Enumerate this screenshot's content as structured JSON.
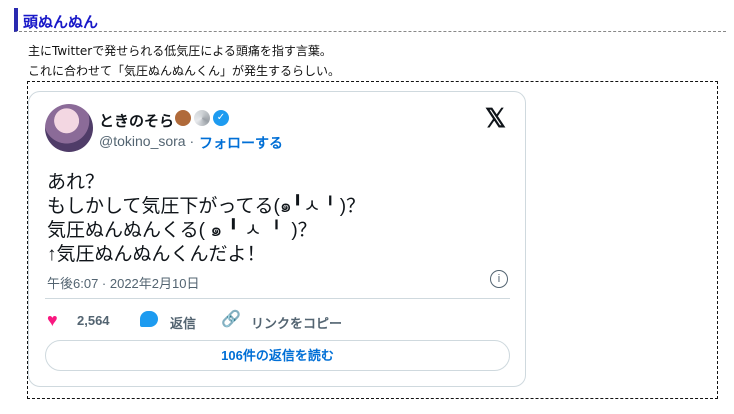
{
  "heading": "頭ぬんぬん",
  "paragraphs": [
    "主にTwitterで発せられる低気圧による頭痛を指す言葉。",
    "これに合わせて「気圧ぬんぬんくん」が発生するらしい。"
  ],
  "tweet": {
    "display_name": "ときのそら",
    "handle": "@tokino_sora",
    "separator": "·",
    "follow_label": "フォローする",
    "x_logo": "𝕏",
    "lines": [
      "あれ？",
      "もしかして気圧下がってる(๑╹ㅅ╹)？",
      "気圧ぬんぬんくる( ๑ ╹ ㅅ ╹ )？",
      "↑気圧ぬんぬんくんだよ！"
    ],
    "timestamp": "午後6:07 · 2022年2月10日",
    "info_glyph": "i",
    "heart_glyph": "♥",
    "likes": "2,564",
    "reply_label": "返信",
    "link_glyph": "🔗",
    "copy_link_label": "リンクをコピー",
    "read_replies_label": "106件の返信を読む"
  },
  "icons": {
    "bear": "bear-emoji-icon",
    "disc": "disc-emoji-icon",
    "verified": "verified-badge-icon",
    "verified_glyph": "✓"
  },
  "colors": {
    "heading_text": "#1818c8",
    "heading_bar": "#2a2ab0",
    "link_blue": "#006fd6",
    "like_pink": "#f91880",
    "reply_blue": "#1d9bf0"
  }
}
